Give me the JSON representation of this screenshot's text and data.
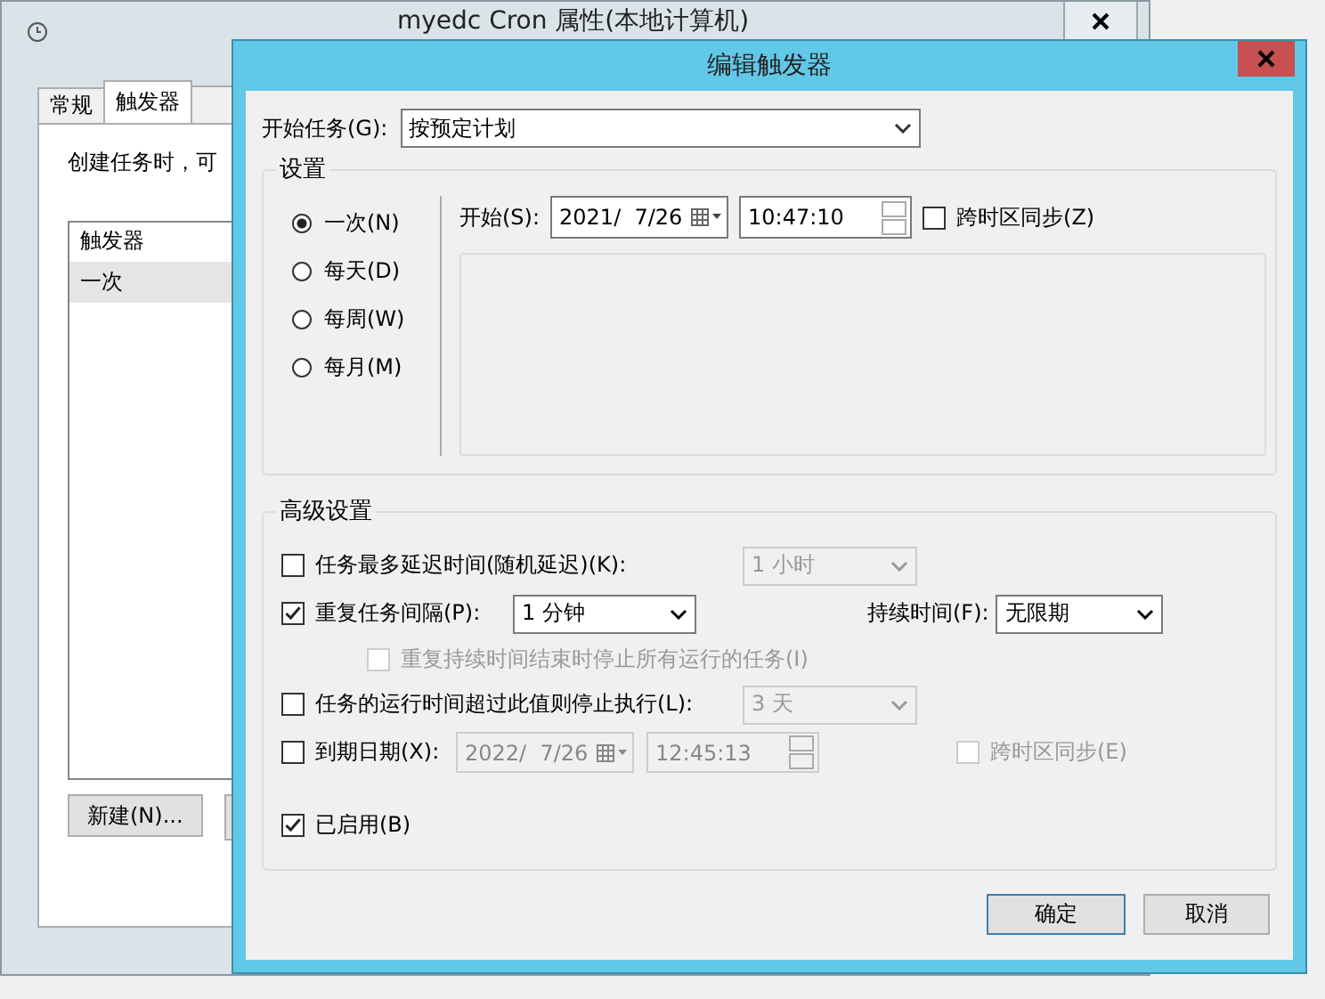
{
  "background_window": {
    "title": "myedc Cron 属性(本地计算机)",
    "tabs": [
      {
        "label": "常规",
        "selected": false
      },
      {
        "label": "触发器",
        "selected": true
      }
    ],
    "description": "创建任务时，可",
    "list": {
      "column": "触发器",
      "rows": [
        {
          "text": "一次",
          "selected": true
        }
      ]
    },
    "buttons": [
      "新建(N)..."
    ]
  },
  "dialog": {
    "title": "编辑触发器",
    "begin_task": {
      "label": "开始任务(G):",
      "value": "按预定计划"
    },
    "settings": {
      "title": "设置",
      "schedule": [
        {
          "label": "一次(N)",
          "selected": true
        },
        {
          "label": "每天(D)",
          "selected": false
        },
        {
          "label": "每周(W)",
          "selected": false
        },
        {
          "label": "每月(M)",
          "selected": false
        }
      ],
      "start": {
        "label": "开始(S):",
        "date": "2021/  7/26",
        "time": "10:47:10"
      },
      "sync": {
        "label": "跨时区同步(Z)",
        "checked": false
      }
    },
    "advanced": {
      "title": "高级设置",
      "delay": {
        "label": "任务最多延迟时间(随机延迟)(K):",
        "checked": false,
        "value": "1 小时"
      },
      "repeat": {
        "label": "重复任务间隔(P):",
        "checked": true,
        "value": "1 分钟",
        "duration_label": "持续时间(F):",
        "duration": "无限期"
      },
      "stop_at_end": {
        "label": "重复持续时间结束时停止所有运行的任务(I)",
        "checked": false,
        "disabled": true
      },
      "stop_if_longer": {
        "label": "任务的运行时间超过此值则停止执行(L):",
        "checked": false,
        "value": "3 天"
      },
      "expire": {
        "label": "到期日期(X):",
        "checked": false,
        "date": "2022/  7/26",
        "time": "12:45:13",
        "sync_label": "跨时区同步(E)",
        "sync_checked": false
      },
      "enabled": {
        "label": "已启用(B)",
        "checked": true
      }
    },
    "buttons": [
      "确定",
      "取消"
    ]
  }
}
